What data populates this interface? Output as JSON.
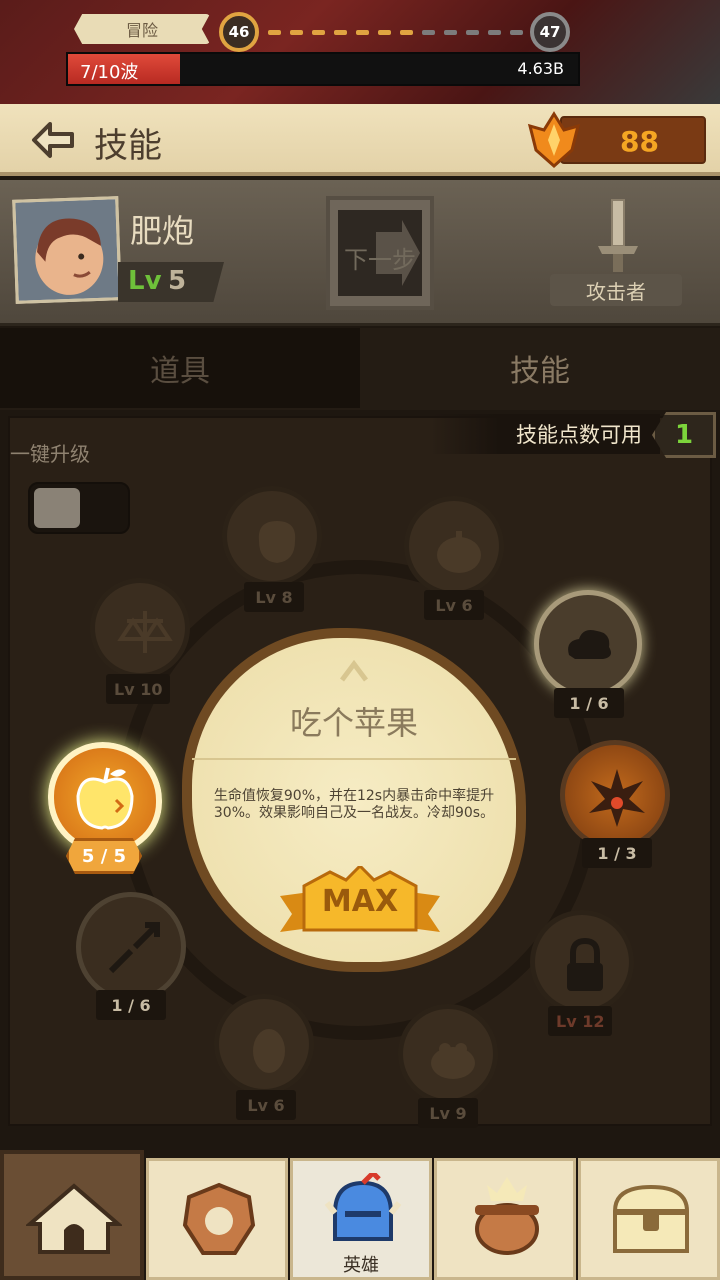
{
  "top": {
    "stage_tag": "冒险",
    "current_level": "46",
    "next_level": "47",
    "wave_text": "7/10波",
    "wave_progress": 0.22,
    "wave_value": "4.63B"
  },
  "header": {
    "title": "技能",
    "resource_count": "88"
  },
  "hero": {
    "name": "肥炮",
    "level_prefix": "Lv",
    "level_value": "5",
    "next_button": "下一步",
    "role": "攻击者"
  },
  "tabs": [
    {
      "label": "道具",
      "active": false
    },
    {
      "label": "技能",
      "active": true
    }
  ],
  "skills": {
    "points_label": "技能点数可用",
    "points": "1",
    "quick_upgrade_label": "一键升级",
    "quick_upgrade_on": false,
    "nodes": [
      {
        "icon": "glove-icon",
        "label": "Lv 8"
      },
      {
        "icon": "pumpkin-icon",
        "label": "Lv 6"
      },
      {
        "icon": "scale-icon",
        "label": "Lv 10"
      },
      {
        "icon": "cloud-icon",
        "label": "1 / 6"
      },
      {
        "icon": "apple-icon",
        "label": "5 / 5"
      },
      {
        "icon": "explosion-icon",
        "label": "1 / 3"
      },
      {
        "icon": "broken-arrow-icon",
        "label": "1 / 6"
      },
      {
        "icon": "lock-icon",
        "label": "Lv 12"
      },
      {
        "icon": "egg-icon",
        "label": "Lv 6"
      },
      {
        "icon": "pig-icon",
        "label": "Lv 9"
      }
    ],
    "popup": {
      "title": "吃个苹果",
      "description": "生命值恢复90%，并在12s内暴击命中率提升30%。效果影响自己及一名战友。冷却90s。",
      "badge": "MAX"
    }
  },
  "nav": [
    {
      "icon": "camp-tent-icon",
      "label": ""
    },
    {
      "icon": "gear-shield-icon",
      "label": ""
    },
    {
      "icon": "knight-helmet-icon",
      "label": "英雄"
    },
    {
      "icon": "cauldron-icon",
      "label": ""
    },
    {
      "icon": "treasure-chest-icon",
      "label": ""
    }
  ],
  "colors": {
    "accent_orange": "#f5a623",
    "progress_red": "#e04a3a",
    "green_level": "#6ec13a",
    "parchment": "#f0e2bc"
  }
}
